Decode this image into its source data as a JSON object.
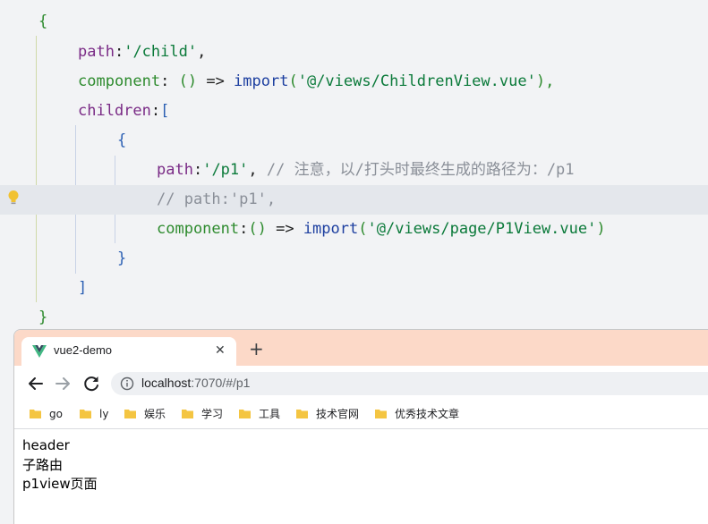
{
  "editor": {
    "lines": {
      "l0": {
        "open_brace": "{"
      },
      "l1": {
        "key": "path",
        "colon": ":",
        "value": "'/child'",
        "comma": ","
      },
      "l2": {
        "key": "component",
        "colon": ": ",
        "parens": "()",
        "arrow": " => ",
        "fn": "import",
        "lparen": "(",
        "value": "'@/views/ChildrenView.vue'",
        "rparen": "),",
        "end": ""
      },
      "l3": {
        "key": "children",
        "colon": ":",
        "bracket": "["
      },
      "l4": {
        "open_brace": "{"
      },
      "l5": {
        "key": "path",
        "colon": ":",
        "value": "'/p1'",
        "comma": ", ",
        "comment": "// 注意，以/打头时最终生成的路径为：/p1"
      },
      "l6": {
        "comment": "// path:'p1',"
      },
      "l7": {
        "key": "component",
        "colon": ":",
        "parens": "()",
        "arrow": " => ",
        "fn": "import",
        "lparen": "(",
        "value": "'@/views/page/P1View.vue'",
        "rparen": ")"
      },
      "l8": {
        "close_brace": "}"
      },
      "l9": {
        "close_bracket": "]"
      },
      "l10": {
        "close_brace": "}"
      }
    },
    "gutter_icon": "lightbulb-icon"
  },
  "browser": {
    "tab": {
      "title": "vue2-demo",
      "close": "✕",
      "favicon": "vue-logo-icon"
    },
    "new_tab": "+",
    "toolbar": {
      "back_icon": "arrow-left-icon",
      "forward_icon": "arrow-right-icon",
      "reload_icon": "reload-icon",
      "url_host": "localhost",
      "url_rest": ":7070/#/p1"
    },
    "bookmarks": [
      "go",
      "ly",
      "娱乐",
      "学习",
      "工具",
      "技术官网",
      "优秀技术文章"
    ],
    "page": {
      "lines": [
        "header",
        "子路由",
        "p1view页面"
      ]
    }
  },
  "colors": {
    "tabstrip": "#fcd9c8",
    "editor_bg": "#f2f3f5",
    "folder": "#f4c542"
  }
}
